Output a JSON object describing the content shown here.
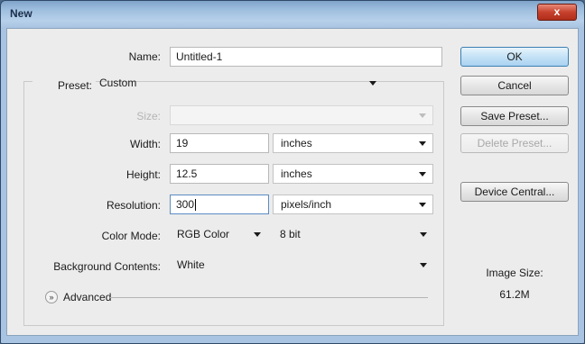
{
  "window": {
    "title": "New",
    "close_glyph": "x"
  },
  "form": {
    "name": {
      "label": "Name:",
      "value": "Untitled-1"
    },
    "preset": {
      "label": "Preset:",
      "value": "Custom"
    },
    "size": {
      "label": "Size:",
      "value": ""
    },
    "width": {
      "label": "Width:",
      "value": "19",
      "unit": "inches"
    },
    "height": {
      "label": "Height:",
      "value": "12.5",
      "unit": "inches"
    },
    "resolution": {
      "label": "Resolution:",
      "value": "300",
      "unit": "pixels/inch"
    },
    "color_mode": {
      "label": "Color Mode:",
      "value": "RGB Color",
      "depth": "8 bit"
    },
    "background": {
      "label": "Background Contents:",
      "value": "White"
    },
    "advanced": {
      "label": "Advanced",
      "icon": "expand-chevron-icon"
    }
  },
  "buttons": {
    "ok": "OK",
    "cancel": "Cancel",
    "save_preset": "Save Preset...",
    "delete_preset": "Delete Preset...",
    "device_central": "Device Central..."
  },
  "image_size": {
    "label": "Image Size:",
    "value": "61.2M"
  }
}
